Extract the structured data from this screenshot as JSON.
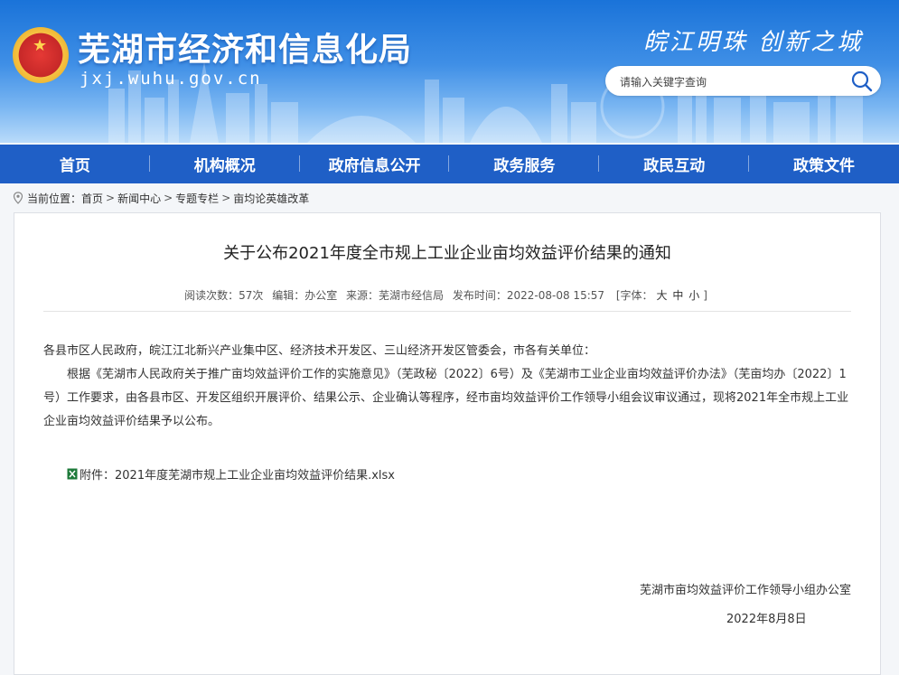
{
  "header": {
    "site_title": "芜湖市经济和信息化局",
    "site_url": "jxj.wuhu.gov.cn",
    "slogan": "皖江明珠 创新之城",
    "search_placeholder": "请输入关键字查询",
    "search_value": ""
  },
  "nav": {
    "items": [
      {
        "label": "首页"
      },
      {
        "label": "机构概况"
      },
      {
        "label": "政府信息公开"
      },
      {
        "label": "政务服务"
      },
      {
        "label": "政民互动"
      },
      {
        "label": "政策文件"
      }
    ]
  },
  "breadcrumb": {
    "prefix": "当前位置：",
    "items": [
      "首页",
      "新闻中心",
      "专题专栏",
      "亩均论英雄改革"
    ],
    "separator": ">"
  },
  "article": {
    "title": "关于公布2021年度全市规上工业企业亩均效益评价结果的通知",
    "meta": {
      "views": "阅读次数：57次",
      "editor": "编辑：办公室",
      "source": "来源：芜湖市经信局",
      "published": "发布时间：2022-08-08 15:57",
      "font_label": "[字体：",
      "font_large": "大",
      "font_medium": "中",
      "font_small": "小",
      "font_close": "]"
    },
    "salutation": "各县市区人民政府，皖江江北新兴产业集中区、经济技术开发区、三山经济开发区管委会，市各有关单位：",
    "paragraph": "根据《芜湖市人民政府关于推广亩均效益评价工作的实施意见》（芜政秘〔2022〕6号）及《芜湖市工业企业亩均效益评价办法》（芜亩均办〔2022〕1号）工作要求，由各县市区、开发区组织开展评价、结果公示、企业确认等程序，经市亩均效益评价工作领导小组会议审议通过，现将2021年全市规上工业企业亩均效益评价结果予以公布。",
    "attachment": "附件：2021年度芜湖市规上工业企业亩均效益评价结果.xlsx",
    "signature": "芜湖市亩均效益评价工作领导小组办公室",
    "date": "2022年8月8日"
  },
  "colors": {
    "nav_bg": "#1f5fc6",
    "header_top": "#1a73d9"
  }
}
